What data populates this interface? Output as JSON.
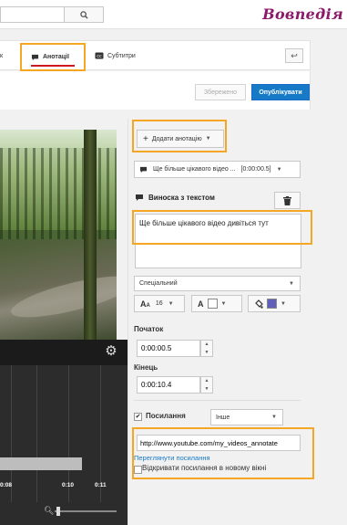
{
  "header": {
    "search_placeholder": "",
    "logo_text": "Вовпедія"
  },
  "tabs": {
    "annotations_label": "Анотації",
    "subtitles_label": "Субтитри",
    "prev_label": "к",
    "back_icon": "undo-arrow-icon"
  },
  "actions": {
    "saved_label": "Збережено",
    "publish_label": "Опублікувати"
  },
  "panel": {
    "add_annotation_label": "Додати анотацію",
    "annotation_list_value": "Ще більше цікавого відео ...",
    "annotation_list_time": "[0:00:00.5]",
    "callout_title": "Виноска з текстом",
    "annotation_text": "Ще більше цікавого відео дивіться тут",
    "style_value": "Спеціальний",
    "font_size": "16",
    "font_color": "#ffffff",
    "background_color": "#6060bb",
    "start_label": "Початок",
    "start_value": "0:00:00.5",
    "end_label": "Кінець",
    "end_value": "0:00:10.4",
    "link_label": "Посилання",
    "link_checked": "✔",
    "link_type": "Інше",
    "url_value": "http://www.youtube.com/my_videos_annotate",
    "view_link_label": "Переглянути посилання",
    "new_window_label": "Відкривати посилання в новому вікні"
  },
  "timeline": {
    "tick_labels": [
      "0:08",
      "0:10",
      "0:11"
    ]
  },
  "colors": {
    "accent_highlight": "#f5a623",
    "publish_blue": "#167ac6",
    "tab_underline": "#cc181e",
    "logo": "#8b1a6b"
  }
}
